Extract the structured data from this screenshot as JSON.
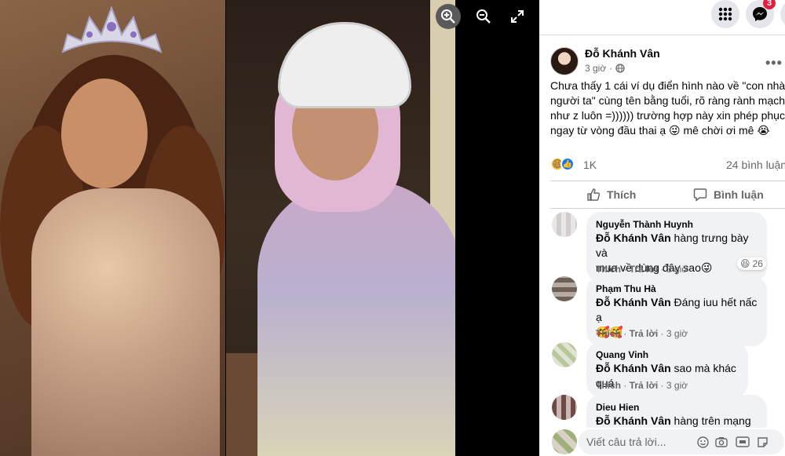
{
  "viewer": {
    "icons": [
      "zoom-in-icon",
      "zoom-out-icon",
      "fullscreen-icon"
    ]
  },
  "topbar": {
    "notification_count": "3",
    "icons": [
      "grid-menu-icon",
      "messenger-icon"
    ]
  },
  "post": {
    "author": "Đỗ Khánh Vân",
    "time": "3 giờ",
    "text": "Chưa thấy 1 cái ví dụ điển hình nào về \"con nhà người ta\" cùng tên bằng tuổi, rõ ràng rành mạch như z luôn =)))))) trường hợp này xin phép phục ngay từ vòng đầu thai ạ 😜 mê chời ơi mê 😭",
    "reaction_count": "1K",
    "comment_count": "24 bình luận",
    "like_label": "Thích",
    "comment_label": "Bình luận"
  },
  "comments": [
    {
      "name": "Nguyễn Thành Huynh",
      "mention": "Đỗ Khánh Vân",
      "text_line1": " hàng trưng bày và",
      "text_line2": "mua về dùng đây sao😜",
      "reaction_count": "26",
      "like": "Thích",
      "reply": "Trả lời",
      "time": "3 giờ"
    },
    {
      "name": "Phạm Thu Hà",
      "mention": "Đỗ Khánh Vân",
      "text_line1": " Đáng iuu hết nấc ạ",
      "text_line2": "🥰🥰",
      "like": "Thích",
      "reply": "Trả lời",
      "time": "3 giờ"
    },
    {
      "name": "Quang Vinh",
      "mention": "Đỗ Khánh Vân",
      "text_line1": " sao mà khác quá",
      "like": "Thích",
      "reply": "Trả lời",
      "time": "3 giờ"
    },
    {
      "name": "Dieu Hien",
      "mention": "Đỗ Khánh Vân",
      "text_line1": " hàng trên mạng và"
    }
  ],
  "reply_box": {
    "placeholder": "Viết câu trả lời...",
    "icons": [
      "emoji-icon",
      "camera-icon",
      "gif-icon",
      "sticker-icon"
    ]
  }
}
